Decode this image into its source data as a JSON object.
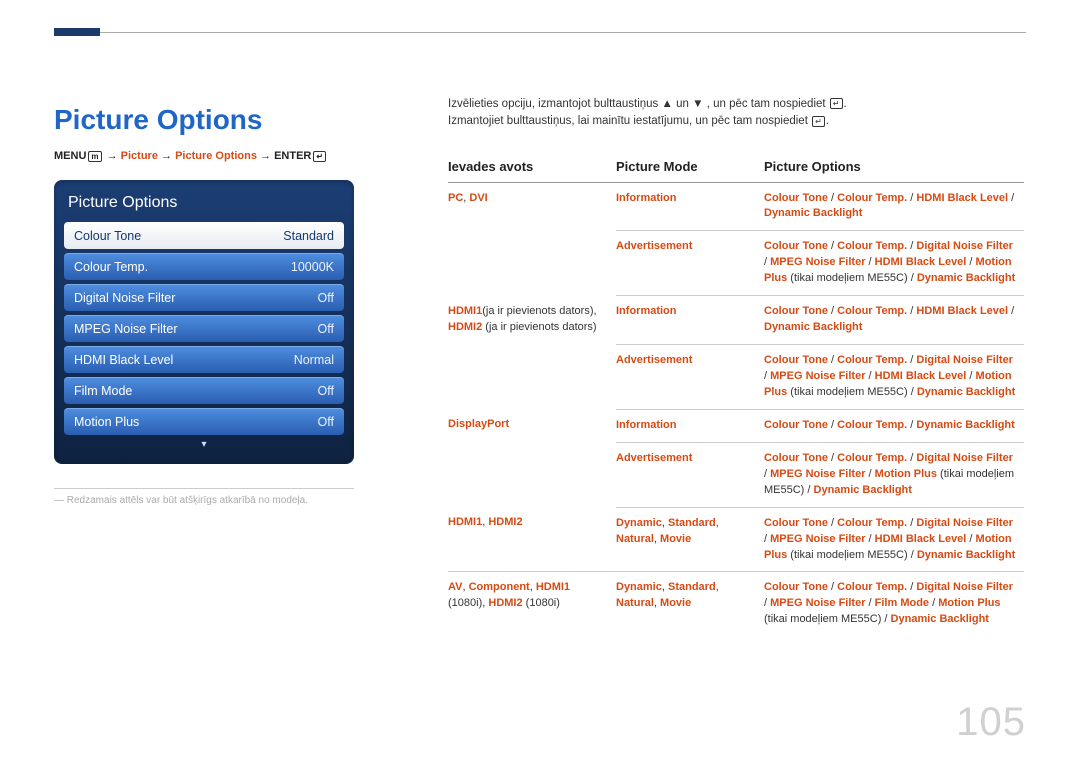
{
  "page_number": "105",
  "title": "Picture Options",
  "breadcrumb": {
    "prefix": "MENU",
    "arrow": " → ",
    "p1": "Picture",
    "p2": "Picture Options",
    "suffix": "ENTER"
  },
  "menu": {
    "title": "Picture Options",
    "items": [
      {
        "label": "Colour Tone",
        "value": "Standard",
        "selected": true
      },
      {
        "label": "Colour Temp.",
        "value": "10000K"
      },
      {
        "label": "Digital Noise Filter",
        "value": "Off"
      },
      {
        "label": "MPEG Noise Filter",
        "value": "Off"
      },
      {
        "label": "HDMI Black Level",
        "value": "Normal"
      },
      {
        "label": "Film Mode",
        "value": "Off"
      },
      {
        "label": "Motion Plus",
        "value": "Off"
      }
    ],
    "scroll_glyph": "▾"
  },
  "footnote": "― Redzamais attēls var būt atšķirīgs atkarībā no modeļa.",
  "intro": {
    "line1a": "Izvēlieties opciju, izmantojot bulttaustiņus ",
    "line1b": " un ",
    "line1c": ", un pēc tam nospiediet ",
    "up": "▲",
    "down": "▼",
    "enter_glyph": "↵",
    "line2a": "Izmantojiet bulttaustiņus, lai mainītu iestatījumu, un pēc tam nospiediet ",
    "period": "."
  },
  "table": {
    "headers": {
      "c1": "Ievades avots",
      "c2": "Picture Mode",
      "c3": "Picture Options"
    },
    "rows": [
      {
        "c1": "<span class='hl'>PC</span>, <span class='hl'>DVI</span>",
        "c2": "<span class='hl'>Information</span>",
        "c3": "<span class='hl'>Colour Tone</span> / <span class='hl'>Colour Temp.</span> / <span class='hl'>HDMI Black Level</span> / <span class='hl'>Dynamic Backlight</span>"
      },
      {
        "c1": "",
        "c2": "<span class='hl'>Advertisement</span>",
        "c3": "<span class='hl'>Colour Tone</span> / <span class='hl'>Colour Temp.</span> / <span class='hl'>Digital Noise Filter</span> / <span class='hl'>MPEG Noise Filter</span> / <span class='hl'>HDMI Black Level</span> / <span class='hl'>Motion Plus</span> <span class='plain'>(tikai modeļiem ME55C)</span> / <span class='hl'>Dynamic Backlight</span>"
      },
      {
        "c1": "<span class='hl'>HDMI1</span><span class='plain'>(ja ir pievienots dators)</span>, <span class='hl'>HDMI2</span> <span class='plain'>(ja ir pievienots dators)</span>",
        "c2": "<span class='hl'>Information</span>",
        "c3": "<span class='hl'>Colour Tone</span> / <span class='hl'>Colour Temp.</span> / <span class='hl'>HDMI Black Level</span> / <span class='hl'>Dynamic Backlight</span>"
      },
      {
        "c1": "",
        "c2": "<span class='hl'>Advertisement</span>",
        "c3": "<span class='hl'>Colour Tone</span> / <span class='hl'>Colour Temp.</span> / <span class='hl'>Digital Noise Filter</span> / <span class='hl'>MPEG Noise Filter</span> / <span class='hl'>HDMI Black Level</span> / <span class='hl'>Motion Plus</span> <span class='plain'>(tikai modeļiem ME55C)</span> / <span class='hl'>Dynamic Backlight</span>"
      },
      {
        "c1": "<span class='hl'>DisplayPort</span>",
        "c2": "<span class='hl'>Information</span>",
        "c3": "<span class='hl'>Colour Tone</span> / <span class='hl'>Colour Temp.</span> / <span class='hl'>Dynamic Backlight</span>"
      },
      {
        "c1": "",
        "c2": "<span class='hl'>Advertisement</span>",
        "c3": "<span class='hl'>Colour Tone</span> / <span class='hl'>Colour Temp.</span> / <span class='hl'>Digital Noise Filter</span> / <span class='hl'>MPEG Noise Filter</span> / <span class='hl'>Motion Plus</span> <span class='plain'>(tikai modeļiem ME55C)</span> / <span class='hl'>Dynamic Backlight</span>"
      },
      {
        "c1": "<span class='hl'>HDMI1</span>, <span class='hl'>HDMI2</span>",
        "c2": "<span class='hl'>Dynamic</span>, <span class='hl'>Standard</span>, <span class='hl'>Natural</span>, <span class='hl'>Movie</span>",
        "c3": "<span class='hl'>Colour Tone</span> / <span class='hl'>Colour Temp.</span> / <span class='hl'>Digital Noise Filter</span> / <span class='hl'>MPEG Noise Filter</span> / <span class='hl'>HDMI Black Level</span> / <span class='hl'>Motion Plus</span> <span class='plain'>(tikai modeļiem ME55C)</span> / <span class='hl'>Dynamic Backlight</span>"
      },
      {
        "c1": "<span class='hl'>AV</span>, <span class='hl'>Component</span>, <span class='hl'>HDMI1</span> <span class='plain'>(1080i)</span>, <span class='hl'>HDMI2</span> <span class='plain'>(1080i)</span>",
        "c2": "<span class='hl'>Dynamic</span>, <span class='hl'>Standard</span>, <span class='hl'>Natural</span>, <span class='hl'>Movie</span>",
        "c3": "<span class='hl'>Colour Tone</span> / <span class='hl'>Colour Temp.</span> / <span class='hl'>Digital Noise Filter</span> / <span class='hl'>MPEG Noise Filter</span> / <span class='hl'>Film Mode</span> / <span class='hl'>Motion Plus</span> <span class='plain'>(tikai modeļiem ME55C)</span> / <span class='hl'>Dynamic Backlight</span>"
      }
    ]
  }
}
